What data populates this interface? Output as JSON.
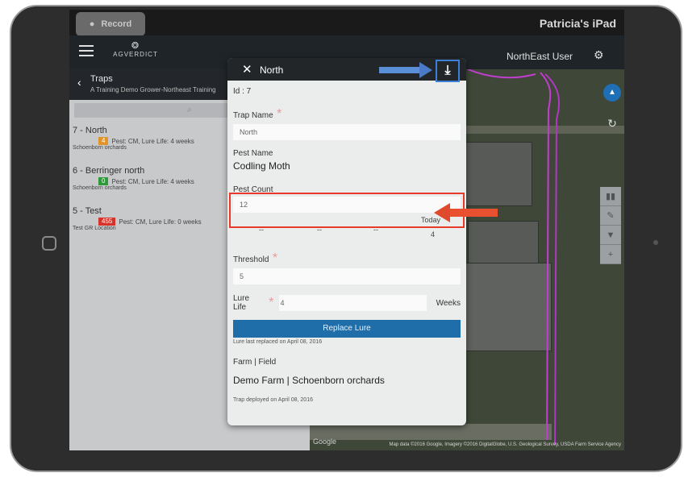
{
  "status_bar": {
    "record_label": "Record",
    "device_name": "Patricia's iPad"
  },
  "app_header": {
    "logo_text": "AGVERDICT",
    "user_name": "NorthEast User"
  },
  "sidebar": {
    "title": "Traps",
    "subtitle": "A Training Demo Grower-Northeast Training",
    "traps": [
      {
        "name": "7 - North",
        "badge": "4",
        "badge_color": "#e0952a",
        "info": "Pest: CM, Lure Life: 4 weeks",
        "location": "Schoenborn orchards"
      },
      {
        "name": "6 - Berringer north",
        "badge": "0",
        "badge_color": "#2f9a3c",
        "info": "Pest: CM, Lure Life: 4 weeks",
        "location": "Schoenborn orchards"
      },
      {
        "name": "5 - Test",
        "badge": "455",
        "badge_color": "#d8332b",
        "info": "Pest: CM, Lure Life: 0 weeks",
        "location": "Test GR Location"
      }
    ]
  },
  "map": {
    "google_label": "Google",
    "data_credit": "Map data ©2016 Google, Imagery ©2016 DigitalGlobe, U.S. Geological Survey, USDA Farm Service Agency"
  },
  "modal": {
    "title": "North",
    "id_text": "Id : 7",
    "trap_name_label": "Trap Name",
    "trap_name_value": "North",
    "pest_name_label": "Pest Name",
    "pest_name_value": "Codling Moth",
    "pest_count_label": "Pest Count",
    "pest_count_value": "12",
    "history_values": [
      "--",
      "--",
      "--"
    ],
    "today_label": "Today",
    "today_value": "4",
    "threshold_label": "Threshold",
    "threshold_value": "5",
    "lure_life_label": "Lure Life",
    "lure_life_value": "4",
    "lure_life_unit": "Weeks",
    "replace_lure_label": "Replace Lure",
    "lure_replaced_note": "Lure last replaced on April 08, 2016",
    "farm_field_label": "Farm | Field",
    "farm_field_value": "Demo Farm | Schoenborn orchards",
    "deployed_note": "Trap deployed on April 08, 2016"
  },
  "colors": {
    "annotation_red": "#e83a2a",
    "annotation_blue": "#4a7ac8",
    "button_blue": "#1f6ea9"
  }
}
